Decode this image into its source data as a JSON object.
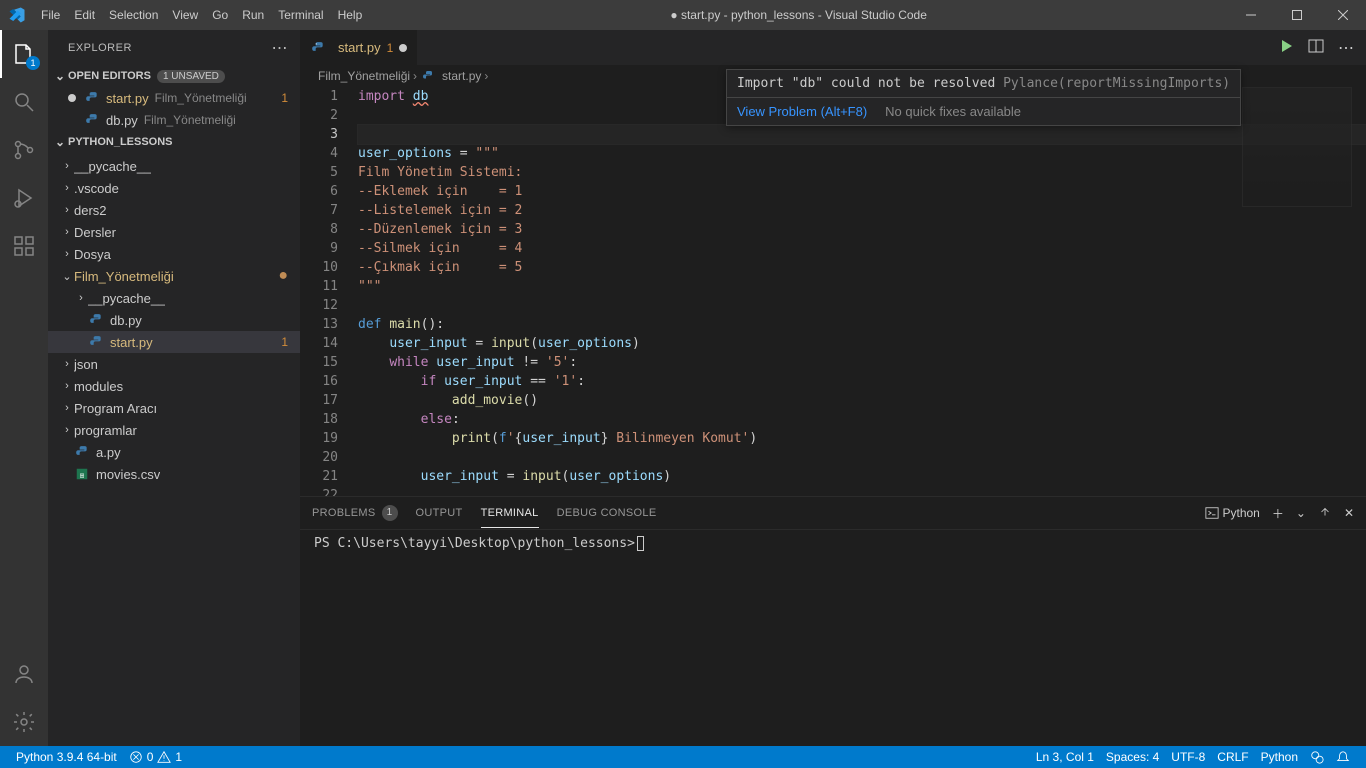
{
  "title": "● start.py - python_lessons - Visual Studio Code",
  "menus": [
    "File",
    "Edit",
    "Selection",
    "View",
    "Go",
    "Run",
    "Terminal",
    "Help"
  ],
  "activity_badge": "1",
  "sidebar": {
    "title": "EXPLORER",
    "open_editors": {
      "header": "OPEN EDITORS",
      "unsaved_badge": "1 UNSAVED",
      "items": [
        {
          "dirty": true,
          "name": "start.py",
          "desc": "Film_Yönetmeliği",
          "tail": "1",
          "kind": "py",
          "warn": true
        },
        {
          "dirty": false,
          "name": "db.py",
          "desc": "Film_Yönetmeliği",
          "tail": "",
          "kind": "py",
          "warn": false
        }
      ]
    },
    "project": {
      "header": "PYTHON_LESSONS",
      "tree": [
        {
          "depth": 0,
          "chev": ">",
          "name": "__pycache__",
          "kind": "folder"
        },
        {
          "depth": 0,
          "chev": ">",
          "name": ".vscode",
          "kind": "folder"
        },
        {
          "depth": 0,
          "chev": ">",
          "name": "ders2",
          "kind": "folder"
        },
        {
          "depth": 0,
          "chev": ">",
          "name": "Dersler",
          "kind": "folder"
        },
        {
          "depth": 0,
          "chev": ">",
          "name": "Dosya",
          "kind": "folder"
        },
        {
          "depth": 0,
          "chev": "⌄",
          "name": "Film_Yönetmeliği",
          "kind": "folder",
          "warn": true,
          "mod": true
        },
        {
          "depth": 1,
          "chev": ">",
          "name": "__pycache__",
          "kind": "folder"
        },
        {
          "depth": 1,
          "chev": "",
          "name": "db.py",
          "kind": "py"
        },
        {
          "depth": 1,
          "chev": "",
          "name": "start.py",
          "kind": "py",
          "warn": true,
          "selected": true,
          "tail": "1"
        },
        {
          "depth": 0,
          "chev": ">",
          "name": "json",
          "kind": "folder"
        },
        {
          "depth": 0,
          "chev": ">",
          "name": "modules",
          "kind": "folder"
        },
        {
          "depth": 0,
          "chev": ">",
          "name": "Program Aracı",
          "kind": "folder"
        },
        {
          "depth": 0,
          "chev": ">",
          "name": "programlar",
          "kind": "folder"
        },
        {
          "depth": 0,
          "chev": "",
          "name": "a.py",
          "kind": "py"
        },
        {
          "depth": 0,
          "chev": "",
          "name": "movies.csv",
          "kind": "csv"
        }
      ]
    }
  },
  "tab": {
    "name": "start.py",
    "badge": "1",
    "dirty": true
  },
  "breadcrumb": [
    "Film_Yönetmeliği",
    "start.py"
  ],
  "hover": {
    "msg_pre": "Import \"db\" could not be resolved ",
    "src": "Pylance",
    "code": "(reportMissingImports)",
    "action": "View Problem (Alt+F8)",
    "noqf": "No quick fixes available"
  },
  "code_lines": [
    {
      "n": 1,
      "html": "<span class='tok-kw'>import</span> <span class='tok-var squiggle'>db</span>"
    },
    {
      "n": 2,
      "html": ""
    },
    {
      "n": 3,
      "html": "",
      "current": true
    },
    {
      "n": 4,
      "html": "<span class='tok-var'>user_options</span> = <span class='tok-str'>\"\"\"</span>"
    },
    {
      "n": 5,
      "html": "<span class='tok-str'>Film Yönetim Sistemi:</span>"
    },
    {
      "n": 6,
      "html": "<span class='tok-str'>--Eklemek için    = 1</span>"
    },
    {
      "n": 7,
      "html": "<span class='tok-str'>--Listelemek için = 2</span>"
    },
    {
      "n": 8,
      "html": "<span class='tok-str'>--Düzenlemek için = 3</span>"
    },
    {
      "n": 9,
      "html": "<span class='tok-str'>--Silmek için     = 4</span>"
    },
    {
      "n": 10,
      "html": "<span class='tok-str'>--Çıkmak için     = 5</span>"
    },
    {
      "n": 11,
      "html": "<span class='tok-str'>\"\"\"</span>"
    },
    {
      "n": 12,
      "html": ""
    },
    {
      "n": 13,
      "html": "<span class='tok-def'>def</span> <span class='tok-fn'>main</span>():"
    },
    {
      "n": 14,
      "html": "    <span class='tok-var'>user_input</span> = <span class='tok-fn'>input</span>(<span class='tok-var'>user_options</span>)"
    },
    {
      "n": 15,
      "html": "    <span class='tok-kw'>while</span> <span class='tok-var'>user_input</span> != <span class='tok-str'>'5'</span>:"
    },
    {
      "n": 16,
      "html": "        <span class='tok-kw'>if</span> <span class='tok-var'>user_input</span> == <span class='tok-str'>'1'</span>:"
    },
    {
      "n": 17,
      "html": "            <span class='tok-fn'>add_movie</span>()"
    },
    {
      "n": 18,
      "html": "        <span class='tok-kw'>else</span>:"
    },
    {
      "n": 19,
      "html": "            <span class='tok-fn'>print</span>(<span class='tok-def'>f</span><span class='tok-str'>'</span>{<span class='tok-var'>user_input</span>}<span class='tok-str'> Bilinmeyen Komut'</span>)"
    },
    {
      "n": 20,
      "html": ""
    },
    {
      "n": 21,
      "html": "        <span class='tok-var'>user_input</span> = <span class='tok-fn'>input</span>(<span class='tok-var'>user_options</span>)"
    },
    {
      "n": 22,
      "html": ""
    }
  ],
  "panel": {
    "tabs": [
      {
        "label": "PROBLEMS",
        "badge": "1"
      },
      {
        "label": "OUTPUT"
      },
      {
        "label": "TERMINAL",
        "active": true
      },
      {
        "label": "DEBUG CONSOLE"
      }
    ],
    "shell": "Python",
    "prompt_prefix": "PS ",
    "prompt_path": "C:\\Users\\tayyi\\Desktop\\python_lessons",
    "prompt_suffix": ">"
  },
  "status": {
    "left": [
      {
        "text": "Python 3.9.4 64-bit"
      }
    ],
    "errwarn": {
      "err": "0",
      "warn": "1"
    },
    "right": [
      "Ln 3, Col 1",
      "Spaces: 4",
      "UTF-8",
      "CRLF",
      "Python"
    ]
  }
}
